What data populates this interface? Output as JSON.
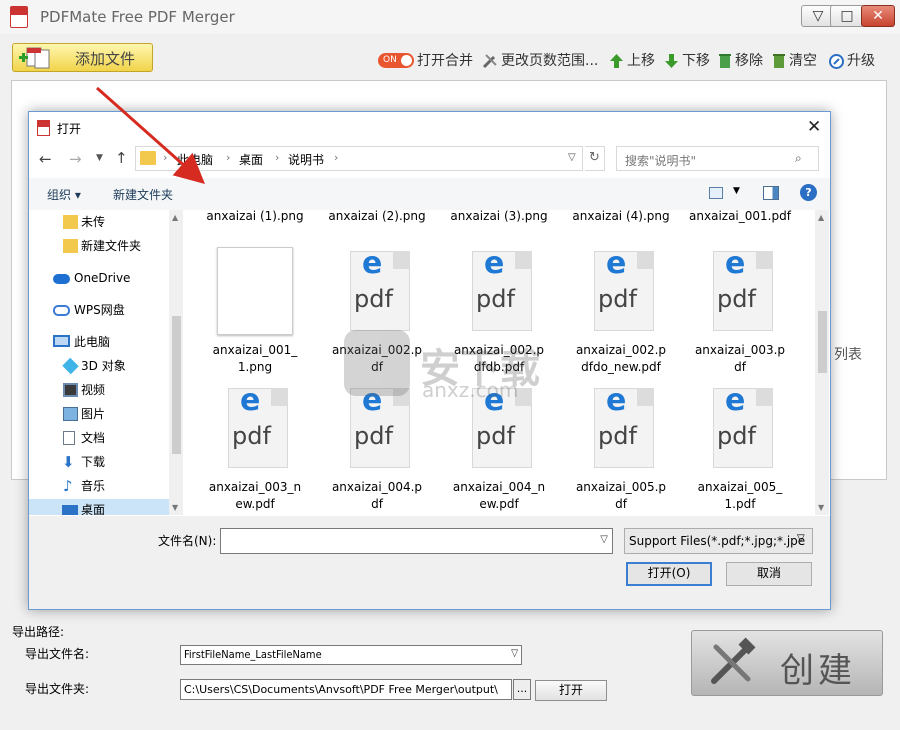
{
  "app": {
    "title": "PDFMate Free PDF Merger",
    "min": "▽",
    "max": "□",
    "close": "✕"
  },
  "toolbar": {
    "add_file": "添加文件",
    "toggle_on": "ON",
    "open_merge": "打开合并",
    "page_range": "更改页数范围...",
    "move_up": "上移",
    "move_down": "下移",
    "remove": "移除",
    "clear": "清空",
    "upgrade": "升级"
  },
  "list": {
    "label": "列表"
  },
  "export": {
    "path_label": "导出路径:",
    "name_label": "导出文件名:",
    "name_value": "FirstFileName_LastFileName",
    "folder_label": "导出文件夹:",
    "folder_value": "C:\\Users\\CS\\Documents\\Anvsoft\\PDF Free Merger\\output\\",
    "browse": "...",
    "open": "打开"
  },
  "create": {
    "label": "创建"
  },
  "dialog": {
    "title": "打开",
    "breadcrumb": [
      "此电脑",
      "桌面",
      "说明书"
    ],
    "search_placeholder": "搜索\"说明书\"",
    "organize": "组织 ▾",
    "new_folder": "新建文件夹",
    "nav": [
      "未传",
      "新建文件夹",
      "OneDrive",
      "WPS网盘",
      "此电脑",
      "3D 对象",
      "视频",
      "图片",
      "文档",
      "下载",
      "音乐",
      "桌面"
    ],
    "files_row0": [
      "anxaizai (1).png",
      "anxaizai (2).png",
      "anxaizai (3).png",
      "anxaizai (4).png",
      "anxaizai_001.pdf"
    ],
    "files_row1": [
      "anxaizai_001_1.png",
      "anxaizai_002.pdf",
      "anxaizai_002.pdfdb.pdf",
      "anxaizai_002.pdfdo_new.pdf",
      "anxaizai_003.pdf"
    ],
    "files_row2": [
      "anxaizai_003_new.pdf",
      "anxaizai_004.pdf",
      "anxaizai_004_new.pdf",
      "anxaizai_005.pdf",
      "anxaizai_005_1.pdf"
    ],
    "pdf_icon_letter": "e",
    "pdf_icon_text": "pdf",
    "filename_label": "文件名(N):",
    "filename_value": "",
    "filter": "Support Files(*.pdf;*.jpg;*.jpe",
    "open_btn": "打开(O)",
    "cancel_btn": "取消",
    "close": "✕"
  },
  "watermark": {
    "text": "安下载",
    "sub": "anxz.com"
  },
  "colors": {
    "accent": "#2b6fc4",
    "arrow": "#d62b20",
    "toggle": "#e8552e"
  }
}
